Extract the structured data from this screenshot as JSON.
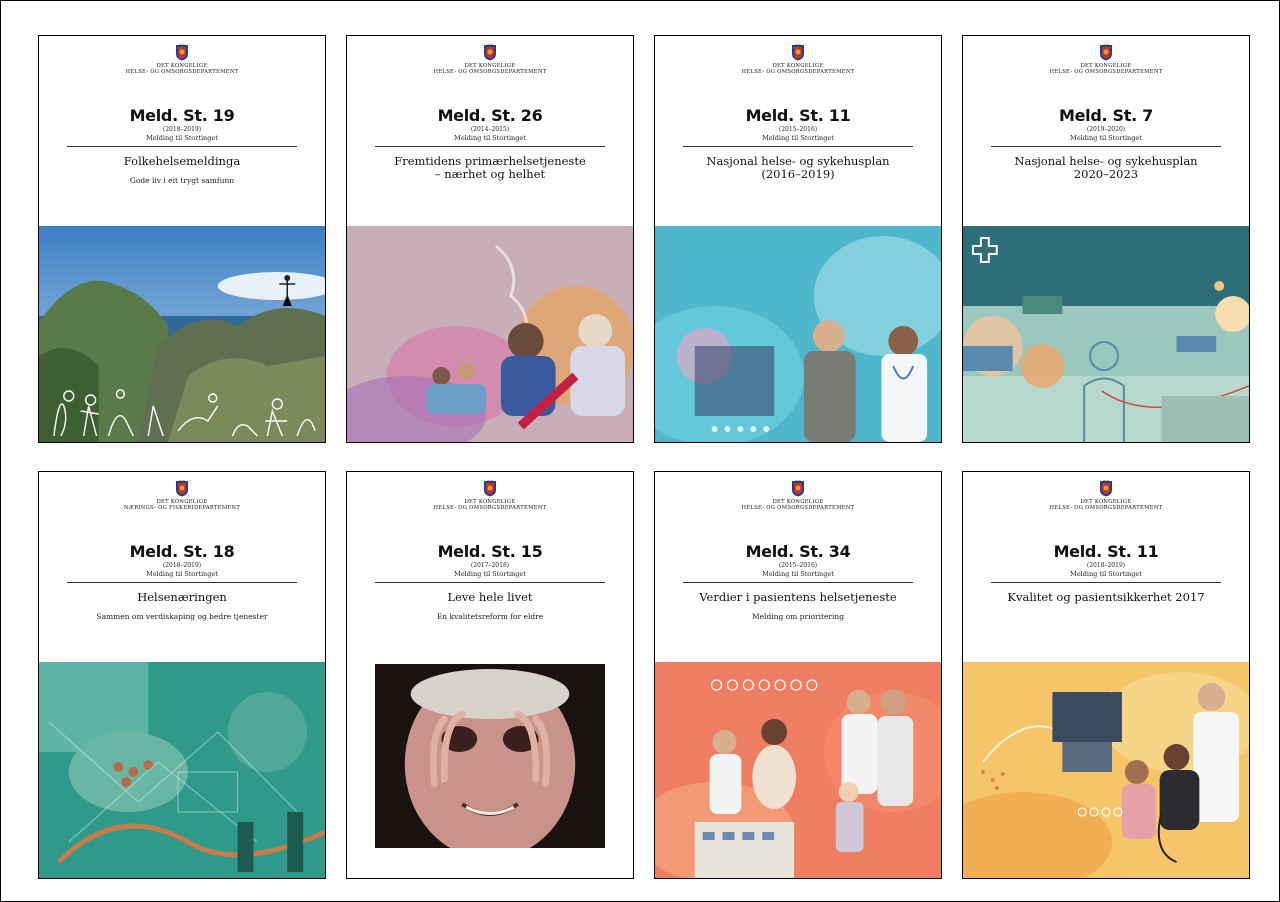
{
  "covers": [
    {
      "department": [
        "DET KONGELIGE",
        "HELSE- OG OMSORGSDEPARTEMENT"
      ],
      "number": "Meld. St. 19",
      "years": "(2018–2019)",
      "melding": "Melding til Stortinget",
      "title": "Folkehelsemeldinga",
      "subtitle": "Gode liv i eit trygt samfunn",
      "image": "mountain-landscape-image"
    },
    {
      "department": [
        "DET KONGELIGE",
        "HELSE- OG OMSORGSDEPARTEMENT"
      ],
      "number": "Meld. St. 26",
      "years": "(2014–2015)",
      "melding": "Melding til Stortinget",
      "title": "Fremtidens primærhelsetjeneste\n– nærhet og helhet",
      "subtitle": "",
      "image": "people-collage-image"
    },
    {
      "department": [
        "DET KONGELIGE",
        "HELSE- OG OMSORGSDEPARTEMENT"
      ],
      "number": "Meld. St. 11",
      "years": "(2015–2016)",
      "melding": "Melding til Stortinget",
      "title": "Nasjonal helse- og sykehusplan\n(2016–2019)",
      "subtitle": "",
      "image": "doctor-and-man-image"
    },
    {
      "department": [
        "DET KONGELIGE",
        "HELSE- OG OMSORGSDEPARTEMENT"
      ],
      "number": "Meld. St. 7",
      "years": "(2019–2020)",
      "melding": "Melding til Stortinget",
      "title": "Nasjonal helse- og sykehusplan\n2020–2023",
      "subtitle": "",
      "image": "hospital-illustration-image"
    },
    {
      "department": [
        "DET KONGELIGE",
        "NÆRINGS- OG FISKERIDEPARTEMENT"
      ],
      "number": "Meld. St. 18",
      "years": "(2018–2019)",
      "melding": "Melding til Stortinget",
      "title": "Helsenæringen",
      "subtitle": "Sammen om verdiskaping og bedre tjenester",
      "image": "green-collage-image"
    },
    {
      "department": [
        "DET KONGELIGE",
        "HELSE- OG OMSORGSDEPARTEMENT"
      ],
      "number": "Meld. St. 15",
      "years": "(2017–2018)",
      "melding": "Melding til Stortinget",
      "title": "Leve hele livet",
      "subtitle": "En kvalitetsreform for eldre",
      "image": "elderly-woman-portrait-image"
    },
    {
      "department": [
        "DET KONGELIGE",
        "HELSE- OG OMSORGSDEPARTEMENT"
      ],
      "number": "Meld. St. 34",
      "years": "(2015–2016)",
      "melding": "Melding til Stortinget",
      "title": "Verdier i pasientens helsetjeneste",
      "subtitle": "Melding om prioritering",
      "image": "family-collage-image"
    },
    {
      "department": [
        "DET KONGELIGE",
        "HELSE- OG OMSORGSDEPARTEMENT"
      ],
      "number": "Meld. St. 11",
      "years": "(2018–2019)",
      "melding": "Melding til Stortinget",
      "title": "Kvalitet og pasientsikkerhet 2017",
      "subtitle": "",
      "image": "patient-care-image"
    }
  ],
  "colors": {
    "crest_blue": "#1f3f8f",
    "crest_gold": "#e0a21c"
  }
}
